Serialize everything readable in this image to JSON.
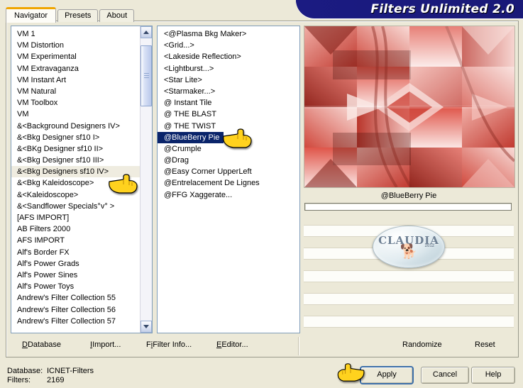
{
  "window": {
    "title": "Filters Unlimited 2.0"
  },
  "tabs": [
    {
      "label": "Navigator",
      "active": true
    },
    {
      "label": "Presets",
      "active": false
    },
    {
      "label": "About",
      "active": false
    }
  ],
  "navigator_list": {
    "selected": "&<Bkg Designers sf10 IV>",
    "items": [
      "VM 1",
      "VM Distortion",
      "VM Experimental",
      "VM Extravaganza",
      "VM Instant Art",
      "VM Natural",
      "VM Toolbox",
      "VM",
      "&<Background Designers IV>",
      "&<Bkg Designer sf10 I>",
      "&<BKg Designer sf10 II>",
      "&<Bkg Designer sf10 III>",
      "&<Bkg Designers sf10 IV>",
      "&<Bkg Kaleidoscope>",
      "&<Kaleidoscope>",
      "&<Sandflower Specials°v° >",
      "[AFS IMPORT]",
      "AB Filters 2000",
      "AFS IMPORT",
      "Alf's Border FX",
      "Alf's Power Grads",
      "Alf's Power Sines",
      "Alf's Power Toys",
      "Andrew's Filter Collection 55",
      "Andrew's Filter Collection 56",
      "Andrew's Filter Collection 57"
    ]
  },
  "filter_list": {
    "selected": "@BlueBerry Pie",
    "items": [
      "<@Plasma Bkg Maker>",
      "<Grid...>",
      "<Lakeside Reflection>",
      "<Lightburst...>",
      "<Star Lite>",
      "<Starmaker...>",
      "@ Instant Tile",
      "@ THE BLAST",
      "@ THE TWIST",
      "@BlueBerry Pie",
      "@Crumple",
      "@Drag",
      "@Easy Corner UpperLeft",
      "@Entrelacement De Lignes",
      "@FFG Xaggerate..."
    ]
  },
  "preview": {
    "caption": "@BlueBerry Pie",
    "watermark": {
      "text": "CLAUDIA",
      "sub": "2012",
      "icon": "dog-icon"
    }
  },
  "toolbar": {
    "database": "Database",
    "import": "Import...",
    "filter_info": "Filter Info...",
    "editor": "Editor...",
    "randomize": "Randomize",
    "reset": "Reset"
  },
  "status": {
    "database_label": "Database:",
    "database_value": "ICNET-Filters",
    "filters_label": "Filters:",
    "filters_value": "2169"
  },
  "buttons": {
    "apply": "Apply",
    "cancel": "Cancel",
    "help": "Help"
  },
  "colors": {
    "banner_bg": "#181878",
    "banner_text": "#ffffff",
    "selection": "#0a246a",
    "tab_accent": "#f0a500",
    "window_bg": "#ece9d8",
    "hand_pointer": "#ffd21e",
    "preview_dominant": "#d9554b"
  }
}
